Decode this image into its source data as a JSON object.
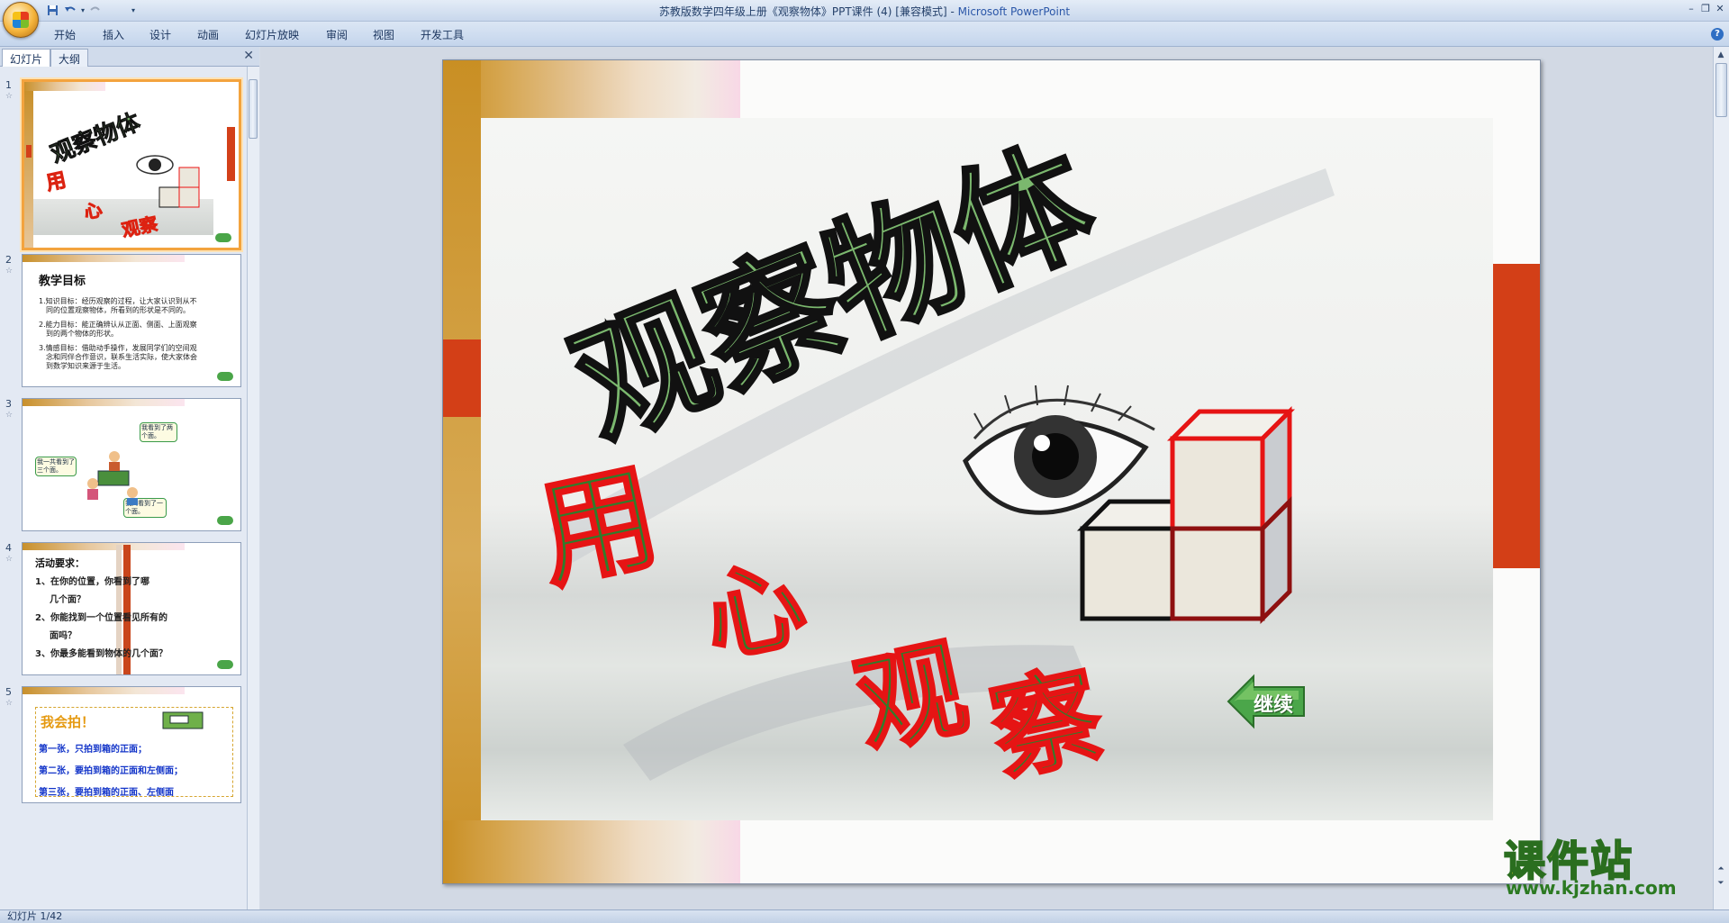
{
  "window": {
    "title": "苏教版数学四年级上册《观察物体》PPT课件 (4) [兼容模式] - ",
    "app_name": "Microsoft PowerPoint"
  },
  "quick_access": [
    "save-icon",
    "undo-icon",
    "redo-icon",
    "customize-icon"
  ],
  "ribbon": {
    "tabs": [
      "开始",
      "插入",
      "设计",
      "动画",
      "幻灯片放映",
      "审阅",
      "视图",
      "开发工具"
    ]
  },
  "pane": {
    "tabs": [
      "幻灯片",
      "大纲"
    ]
  },
  "thumbnails": [
    {
      "num": "1"
    },
    {
      "num": "2",
      "title": "教学目标",
      "lines": [
        "1.知识目标：经历观察的过程，让大家认识到从不",
        "同的位置观察物体，所看到的形状是不同的。",
        "2.能力目标：能正确辨认从正面、侧面、上面观察",
        "到的两个物体的形状。",
        "3.情感目标：借助动手操作，发展同学们的空间观",
        "念和同伴合作意识，联系生活实际，使大家体会",
        "到数学知识来源于生活。"
      ]
    },
    {
      "num": "3",
      "bubbles": [
        "我看到了两个面。",
        "我一共看到了三个面。",
        "我只看到了一个面。"
      ]
    },
    {
      "num": "4",
      "title": "活动要求：",
      "lines": [
        "1、在你的位置，你看到了哪",
        "几个面？",
        "2、你能找到一个位置看见所有的",
        "面吗？",
        "3、你最多能看到物体的几个面？"
      ]
    },
    {
      "num": "5",
      "title": "我会拍！",
      "lines": [
        "第一张，只拍到箱的正面；",
        "第二张，要拍到箱的正面和左侧面；",
        "第三张，要拍到箱的正面、左侧面"
      ]
    }
  ],
  "slide": {
    "title": "观察物体",
    "subtitle": "用心观察",
    "continue_button": "继续"
  },
  "statusbar": {
    "slide_info": "幻灯片 1/42"
  },
  "watermark": {
    "text": "课件站",
    "url": "www.kjzhan.com"
  }
}
